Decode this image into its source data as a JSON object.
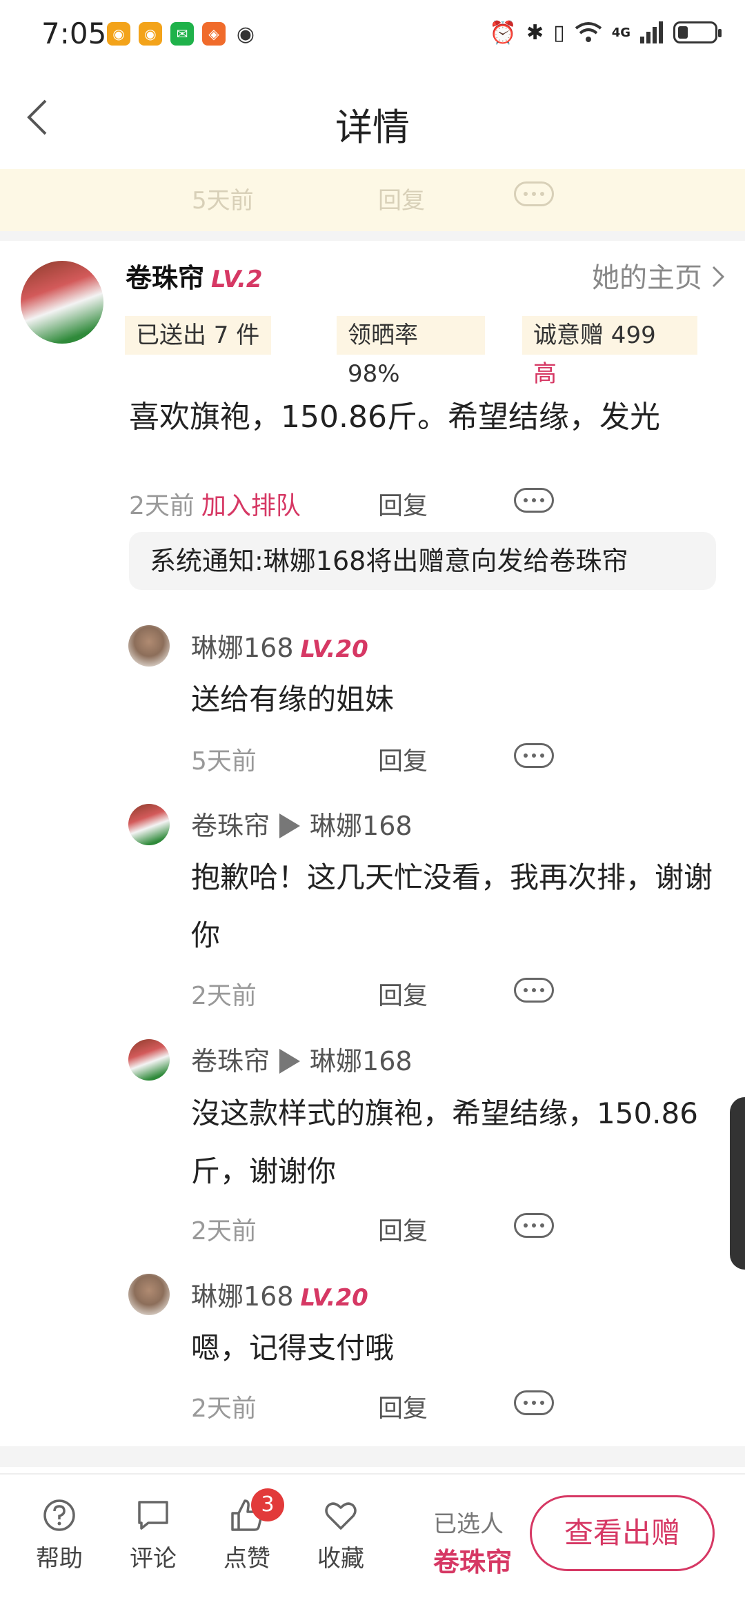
{
  "status_bar": {
    "time": "7:05",
    "network": "4G",
    "icons": [
      "weibo-icon",
      "weibo-icon",
      "wechat-icon",
      "shop-icon",
      "eye-icon",
      "alarm-icon",
      "bluetooth-icon",
      "vibrate-icon",
      "wifi-icon",
      "signal-icon",
      "battery-icon"
    ]
  },
  "header": {
    "title": "详情"
  },
  "banner": {
    "time": "5天前",
    "reply": "回复"
  },
  "post": {
    "user_name": "卷珠帘",
    "level": "LV.2",
    "homepage_link": "她的主页",
    "tags": {
      "sent": "已送出 7 件",
      "receive_rate": "领晒率 98%",
      "sincerity": "诚意赠 499",
      "sincerity_level": "高"
    },
    "content": "喜欢旗袍，150.86斤。希望结缘，发光",
    "time": "2天前",
    "join_queue": "加入排队",
    "reply": "回复",
    "system_notice": "系统通知:琳娜168将出赠意向发给卷珠帘"
  },
  "comments": [
    {
      "name": "琳娜168",
      "level": "LV.20",
      "reply_to": "",
      "text": "送给有缘的姐妹",
      "time": "5天前",
      "reply": "回复"
    },
    {
      "name": "卷珠帘",
      "level": "",
      "reply_to": "琳娜168",
      "text": "抱歉哈！这几天忙没看，我再次排，谢谢你",
      "time": "2天前",
      "reply": "回复"
    },
    {
      "name": "卷珠帘",
      "level": "",
      "reply_to": "琳娜168",
      "text": "沒这款样式的旗袍，希望结缘，150.86斤，谢谢你",
      "time": "2天前",
      "reply": "回复"
    },
    {
      "name": "琳娜168",
      "level": "LV.20",
      "reply_to": "",
      "text": "嗯，记得支付哦",
      "time": "2天前",
      "reply": "回复"
    }
  ],
  "bottom_bar": {
    "help": "帮助",
    "comment": "评论",
    "like": "点赞",
    "like_count": "3",
    "favorite": "收藏",
    "selected_label": "已选人",
    "selected_name": "卷珠帘",
    "cta": "查看出赠"
  },
  "colors": {
    "accent": "#d63864",
    "tag_bg": "#fdf5e3",
    "banner_bg": "#fdf8e5"
  }
}
